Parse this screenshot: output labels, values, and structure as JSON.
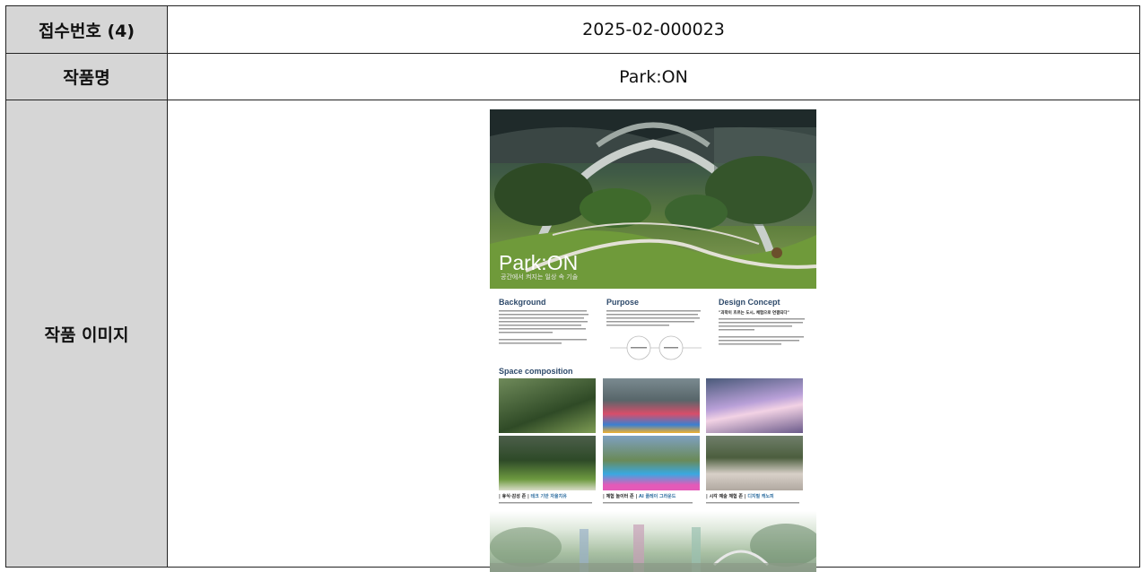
{
  "form": {
    "rows": [
      {
        "label": "접수번호 (4)",
        "value": "2025-02-000023"
      },
      {
        "label": "작품명",
        "value": "Park:ON"
      },
      {
        "label": "작품 이미지"
      }
    ]
  },
  "poster": {
    "title": "Park:ON",
    "subtitle": "공간에서 켜지는 일상 속 기술",
    "sections": {
      "background": "Background",
      "purpose": "Purpose",
      "design_concept": "Design Concept",
      "space_composition": "Space composition"
    },
    "concept_quote": "\"과학이 흐르는 도시, 체험으로 연결되다\"",
    "captions": [
      {
        "zone": "| 휴식·감성 존 |",
        "name": "테크 기반 자율치유"
      },
      {
        "zone": "| 체험 놀이터 존 |",
        "name": "AI 플레이 그라운드"
      },
      {
        "zone": "| 시각 예술 체험 존 |",
        "name": "디지털 캐노피"
      }
    ]
  }
}
